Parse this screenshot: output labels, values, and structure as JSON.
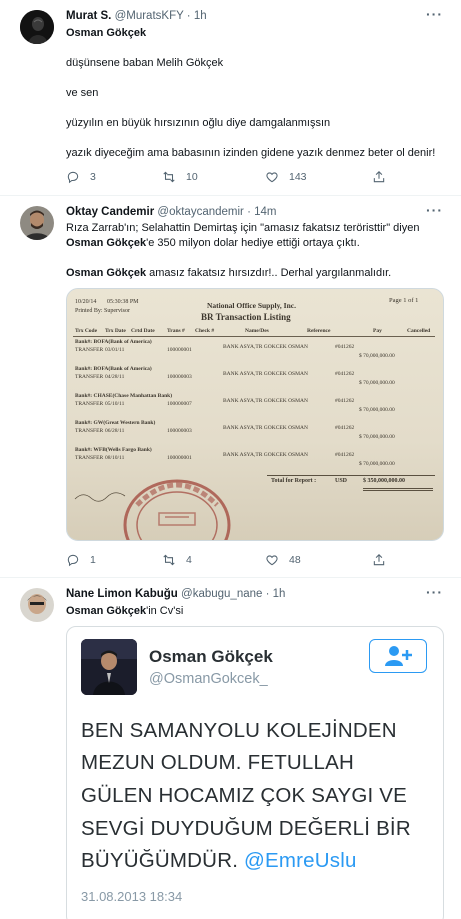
{
  "tweets": [
    {
      "name": "Murat S.",
      "handle": "@MuratsKFY",
      "time": "1h",
      "lines": [
        "düşünsene baban Melih Gökçek",
        "ve sen",
        "yüzyılın en büyük hırsızının oğlu diye damgalanmışsın",
        "yazık diyeceğim ama babasının izinden gidene yazık denmez beter ol denir!"
      ],
      "reply_to": "Osman Gökçek",
      "replies": "3",
      "retweets": "10",
      "likes": "143"
    },
    {
      "name": "Oktay Candemir",
      "handle": "@oktaycandemir",
      "time": "14m",
      "line1": "Rıza Zarrab'ın; Selahattin Demirtaş için \"amasız fakatsız teröristtir\" diyen",
      "line2_bold": "Osman Gökçek",
      "line2_rest": "'e 350 milyon dolar hediye ettiği ortaya çıktı.",
      "line3_bold": "Osman Gökçek",
      "line3_rest": " amasız fakatsız hırsızdır!.. Derhal yargılanmalıdır.",
      "replies": "1",
      "retweets": "4",
      "likes": "48"
    },
    {
      "name": "Nane Limon Kabuğu",
      "handle": "@kabugu_nane",
      "time": "1h",
      "line_bold": "Osman Gökçek",
      "line_rest": "'in Cv'si"
    }
  ],
  "header_dot": "·",
  "more_label": "···",
  "document": {
    "company": "National Office Supply, Inc.",
    "title": "BR Transaction Listing",
    "page": "Page 1 of 1",
    "date": "10/20/14",
    "time": "05:30:38 PM",
    "printed_by": "Printed By: Supervisor",
    "columns": [
      "Trx Code",
      "Trx Date",
      "Crtd Date",
      "Trans #",
      "Check #",
      "Name/Des",
      "Reference",
      "Pay",
      "Cancelled"
    ],
    "rows": [
      {
        "bank": "Bank#:  BOFA(Bank of America)",
        "code": "TRANSFER",
        "date": "03/01/11",
        "trans": "100000001",
        "name": "BANK ASYA,TR GOKCEK OSMAN",
        "ref": "#041262",
        "amount": "$ 70,000,000.00"
      },
      {
        "bank": "Bank#:  BOFA(Bank of America)",
        "code": "TRANSFER",
        "date": "04/28/11",
        "trans": "100000003",
        "name": "BANK ASYA,TR GOKCEK OSMAN",
        "ref": "#041262",
        "amount": "$ 70,000,000.00"
      },
      {
        "bank": "Bank#:  CHASE(Chase Manhattan Bank)",
        "code": "TRANSFER",
        "date": "05/10/11",
        "trans": "100000007",
        "name": "BANK ASYA,TR GOKCEK OSMAN",
        "ref": "#041262",
        "amount": "$ 70,000,000.00"
      },
      {
        "bank": "Bank#:  GW(Great Western Bank)",
        "code": "TRANSFER",
        "date": "06/28/11",
        "trans": "100000003",
        "name": "BANK ASYA,TR GOKCEK OSMAN",
        "ref": "#041262",
        "amount": "$ 70,000,000.00"
      },
      {
        "bank": "Bank#:  WFB(Wells Fargo Bank)",
        "code": "TRANSFER",
        "date": "08/10/11",
        "trans": "100000001",
        "name": "BANK ASYA,TR GOKCEK OSMAN",
        "ref": "#041262",
        "amount": "$ 70,000,000.00"
      }
    ],
    "total_label": "Total for Report :",
    "total_currency": "USD",
    "total": "$ 350,000,000.00"
  },
  "embed": {
    "name": "Osman Gökçek",
    "handle": "@OsmanGokcek_",
    "lines": [
      "BEN SAMANYOLU KOLEJİNDEN",
      "MEZUN OLDUM. FETULLAH",
      "GÜLEN HOCAMIZ ÇOK SAYGI VE",
      "SEVGİ  DUYDUĞUM DEĞERLİ BİR"
    ],
    "last_line": "BÜYÜĞÜMDÜR.",
    "mention": "@EmreUslu",
    "date": "31.08.2013 18:34"
  },
  "colors": {
    "text": "#0f1419",
    "secondary": "#536471",
    "divider": "#eff3f4",
    "link": "#2b9af3"
  }
}
